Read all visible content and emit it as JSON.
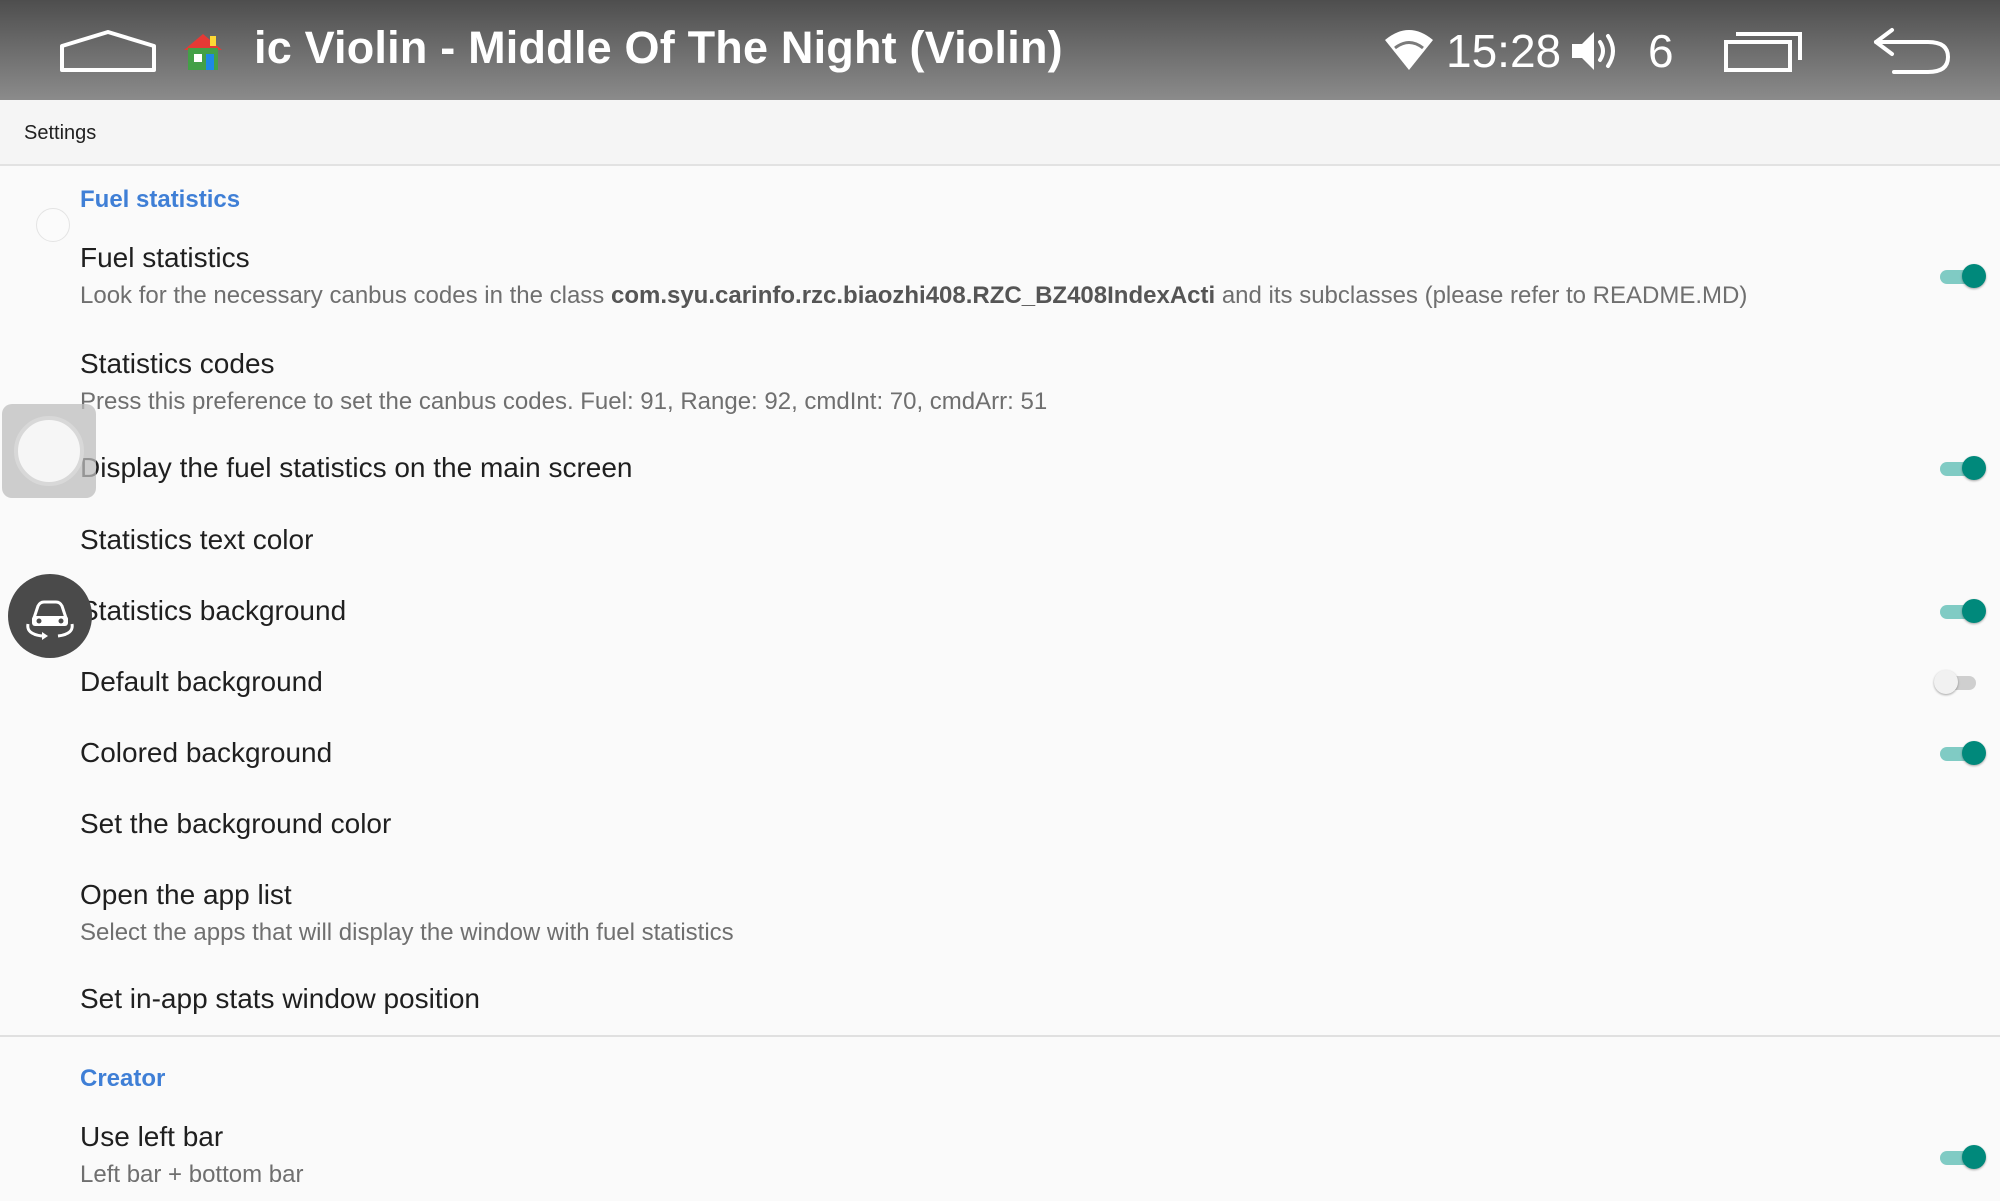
{
  "status_bar": {
    "title": "ic Violin - Middle Of The Night (Violin)",
    "time": "15:28",
    "volume_level": "6",
    "icons": [
      "home-icon",
      "app-icon",
      "wifi-icon",
      "volume-icon",
      "recent-apps-icon",
      "back-icon"
    ]
  },
  "toolbar": {
    "title": "Settings"
  },
  "categories": {
    "fuel": "Fuel statistics",
    "creator": "Creator"
  },
  "prefs": {
    "fuel_statistics": {
      "title": "Fuel statistics",
      "summary_prefix": "Look for the necessary canbus codes in the class ",
      "summary_class": "com.syu.carinfo.rzc.biaozhi408.RZC_BZ408IndexActi",
      "summary_suffix": " and its subclasses (please refer to README.MD)",
      "enabled": true
    },
    "statistics_codes": {
      "title": "Statistics codes",
      "summary": "Press this preference to set the canbus codes. Fuel: 91, Range: 92, cmdInt: 70, cmdArr: 51"
    },
    "display_main": {
      "title": "Display the fuel statistics on the main screen",
      "enabled": true
    },
    "text_color": {
      "title": "Statistics text color"
    },
    "stats_background": {
      "title": "Statistics background",
      "enabled": true
    },
    "default_background": {
      "title": "Default background",
      "enabled": false
    },
    "colored_background": {
      "title": "Colored background",
      "enabled": true
    },
    "background_color": {
      "title": "Set the background color"
    },
    "app_list": {
      "title": "Open the app list",
      "summary": "Select the apps that will display the window with fuel statistics"
    },
    "window_position": {
      "title": "Set in-app stats window position"
    },
    "left_bar": {
      "title": "Use left bar",
      "summary": "Left bar + bottom bar",
      "enabled": true
    }
  },
  "colors": {
    "accent": "#00897b",
    "category": "#3f7fd6",
    "status_bar": "#5a5a5a"
  }
}
